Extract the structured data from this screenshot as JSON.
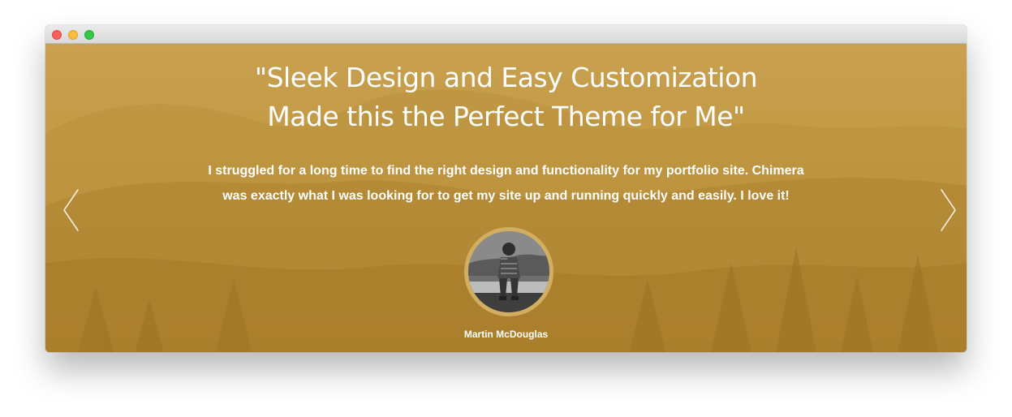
{
  "testimonial": {
    "headline_line1": "\"Sleek Design and Easy Customization",
    "headline_line2": "Made this the Perfect Theme for Me\"",
    "body_line1": "I struggled for a long time to find the right design and functionality for my portfolio site. Chimera",
    "body_line2": "was exactly what I was looking for to get my site up and running quickly and easily. I love it!",
    "author_name": "Martin McDouglas"
  },
  "icons": {
    "prev": "chevron-left-icon",
    "next": "chevron-right-icon"
  },
  "colors": {
    "overlay": "#c79d4a",
    "text": "#ffffff",
    "avatar_ring": "#d2ae62"
  }
}
